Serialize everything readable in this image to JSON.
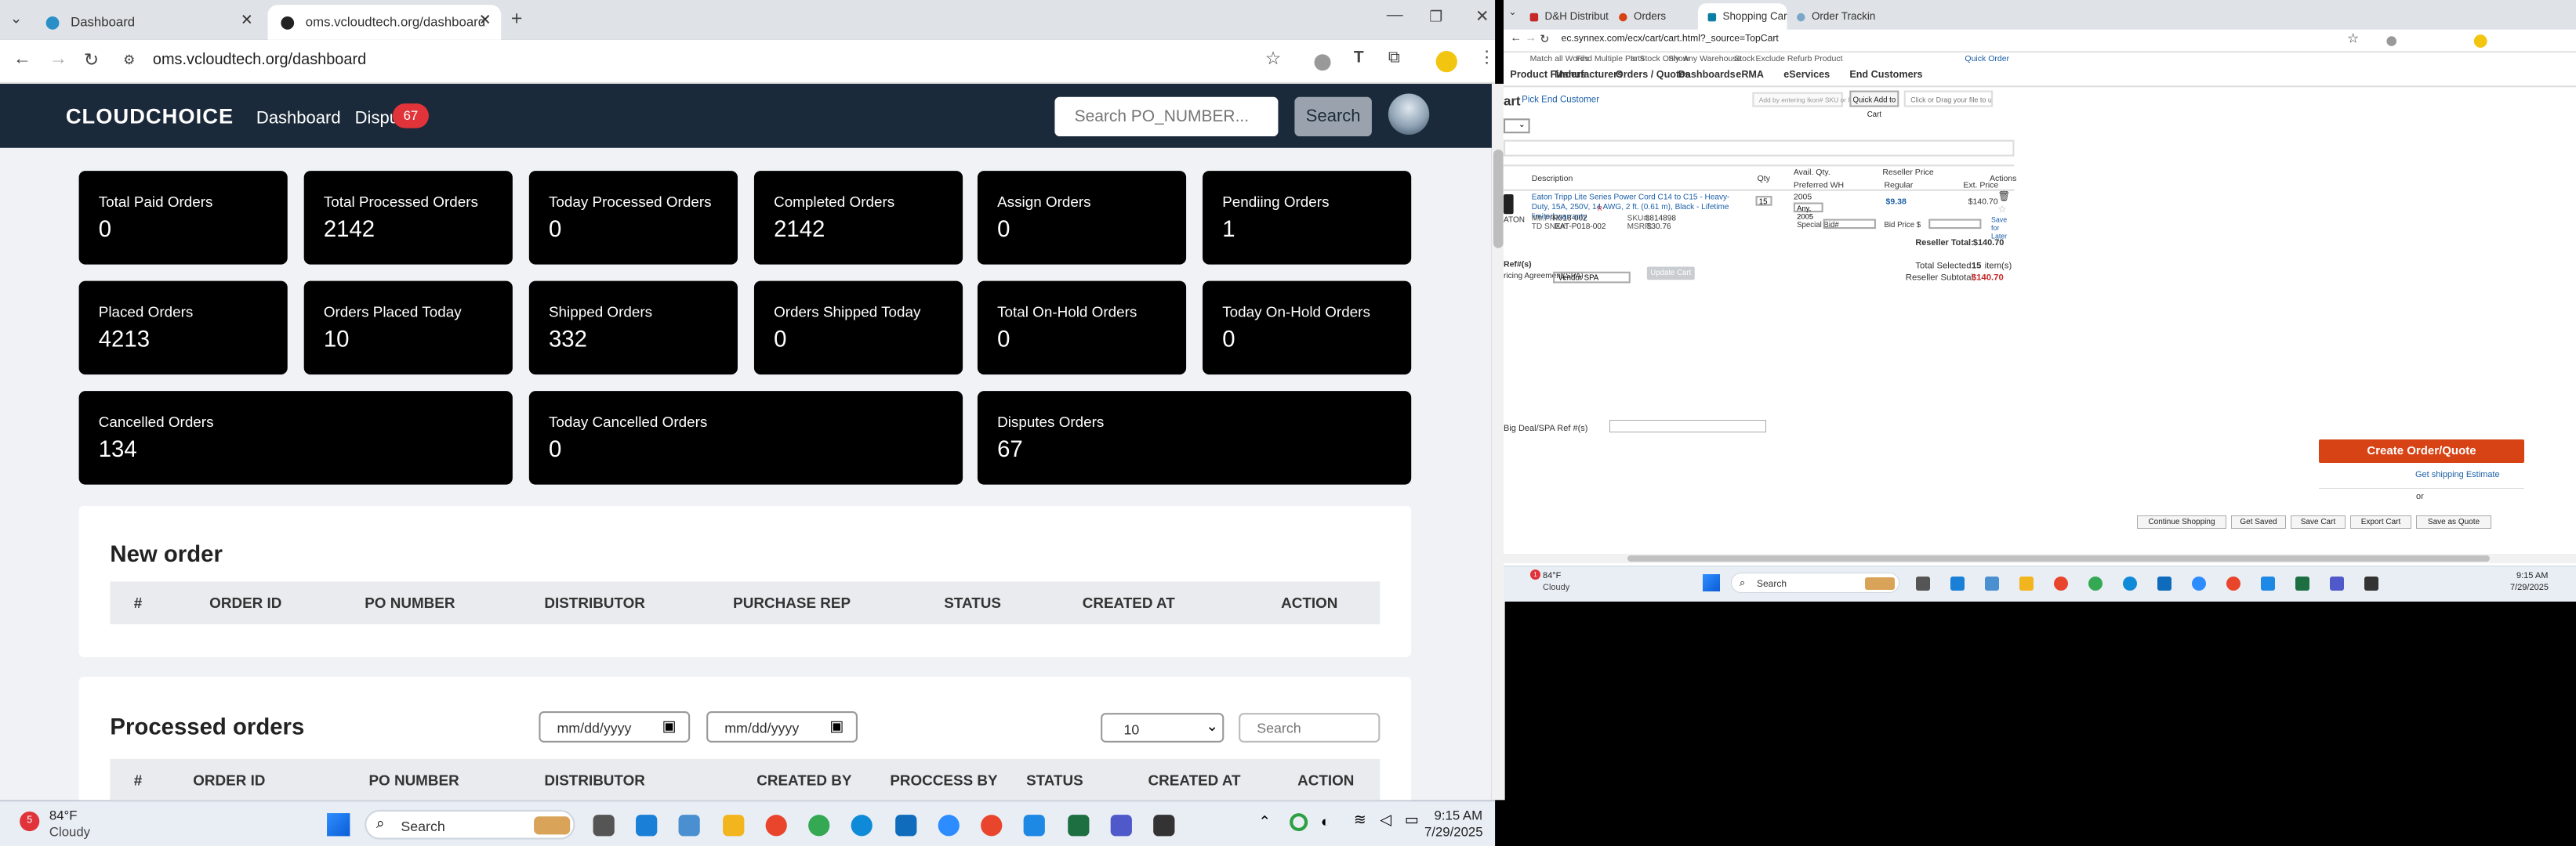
{
  "left_window": {
    "tabs": [
      {
        "title": "Dashboard"
      },
      {
        "title": "oms.vcloudtech.org/dashboard"
      }
    ],
    "new_tab": "+",
    "url": "oms.vcloudtech.org/dashboard",
    "nav": {
      "logo": "CLOUDCHOICE",
      "links": [
        "Dashboard",
        "Dispu"
      ],
      "disputes_badge": "67",
      "search_placeholder": "Search PO_NUMBER...",
      "search_button": "Search"
    },
    "stats": [
      {
        "label": "Total Paid Orders",
        "value": "0"
      },
      {
        "label": "Total Processed Orders",
        "value": "2142"
      },
      {
        "label": "Today Processed Orders",
        "value": "0"
      },
      {
        "label": "Completed Orders",
        "value": "2142"
      },
      {
        "label": "Assign Orders",
        "value": "0"
      },
      {
        "label": "Pendiing Orders",
        "value": "1"
      },
      {
        "label": "Placed Orders",
        "value": "4213"
      },
      {
        "label": "Orders Placed Today",
        "value": "10"
      },
      {
        "label": "Shipped Orders",
        "value": "332"
      },
      {
        "label": "Orders Shipped Today",
        "value": "0"
      },
      {
        "label": "Total On-Hold Orders",
        "value": "0"
      },
      {
        "label": "Today On-Hold Orders",
        "value": "0"
      },
      {
        "label": "Cancelled Orders",
        "value": "134"
      },
      {
        "label": "Today Cancelled Orders",
        "value": "0"
      },
      {
        "label": "Disputes Orders",
        "value": "67"
      }
    ],
    "new_order": {
      "title": "New order",
      "columns": [
        "#",
        "ORDER ID",
        "PO NUMBER",
        "DISTRIBUTOR",
        "PURCHASE REP",
        "STATUS",
        "CREATED AT",
        "ACTION"
      ]
    },
    "processed_orders": {
      "title": "Processed orders",
      "date_from_placeholder": "mm/dd/yyyy",
      "date_to_placeholder": "mm/dd/yyyy",
      "page_size": "10",
      "search_placeholder": "Search",
      "columns": [
        "#",
        "ORDER ID",
        "PO NUMBER",
        "DISTRIBUTOR",
        "CREATED BY",
        "PROCCESS BY",
        "STATUS",
        "CREATED AT",
        "ACTION"
      ]
    },
    "taskbar": {
      "weather_temp": "84°F",
      "weather_desc": "Cloudy",
      "weather_badge": "5",
      "search": "Search",
      "time": "9:15 AM",
      "date": "7/29/2025"
    }
  },
  "right_window": {
    "tabs": [
      {
        "title": "D&H Distributing"
      },
      {
        "title": "Orders"
      },
      {
        "title": "Shopping Cart- ECExpress - TD"
      },
      {
        "title": "Order Tracking"
      }
    ],
    "url": "ec.synnex.com/ecx/cart/cart.html?_source=TopCart",
    "filters": [
      "Match all Words",
      "Find Multiple Parts",
      "In Stock Only",
      "Show",
      "Any Warehouse",
      "Stock",
      "Exclude Refurb Product",
      "Quick Order"
    ],
    "menu": [
      "Product Finders",
      "Manufacturers",
      "Orders / Quotes",
      "Dashboards",
      "eRMA",
      "eServices",
      "End Customers"
    ],
    "cart_title": "art",
    "pick_end_customer": "Pick End Customer",
    "add_placeholder": "Add by entering Ikon# SKU or Part Number",
    "quick_add": "Quick Add to Cart",
    "upload_text": "Click or Drag your file to upload (.csv)",
    "headers": {
      "description": "Description",
      "qty": "Qty",
      "avail": "Avail. Qty.",
      "preferred": "Preferred WH",
      "reseller_price": "Reseller Price",
      "regular": "Regular",
      "ext_price": "Ext. Price",
      "actions": "Actions"
    },
    "item": {
      "description": "Eaton Tripp Lite Series Power Cord C14 to C15 - Heavy-Duty, 15A, 250V, 14 AWG, 2 ft. (0.61 m), Black - Lifetime limited warranty",
      "desc_badge": "R",
      "qty": "15",
      "avail": "2005",
      "warehouse": "Any, 2005",
      "regular": "$9.38",
      "ext": "$140.70",
      "vendor": "ATON",
      "mfr_pn_label": "Mfr.P/N:",
      "mfr_pn": "P018-002",
      "td_snx_label": "TD SNX#:",
      "td_snx": "EAT-P018-002",
      "sku_label": "SKU#:",
      "sku": "3814898",
      "msrp_label": "MSRP:",
      "msrp": "$30.76",
      "special_bid": "Special Bid#",
      "bid_price": "Bid Price $",
      "save_later": "Save for Later"
    },
    "reseller_total_label": "Reseller Total:",
    "reseller_total": "$140.70",
    "ref": {
      "title": "Ref#(s)",
      "agreement_label": "ricing Agreement(SPA)",
      "agreement_value": "Vendor SPA",
      "big_deal_label": "Big Deal/SPA Ref #(s)"
    },
    "update_cart": "Update Cart",
    "total_selected_label": "Total Selected:",
    "total_selected_value": "15",
    "total_selected_unit": "item(s)",
    "reseller_subtotal_label": "Reseller Subtotal:",
    "reseller_subtotal": "$140.70",
    "create_order": "Create Order/Quote",
    "shipping_estimate": "Get shipping Estimate",
    "or": "or",
    "bottom_buttons": [
      "Continue Shopping",
      "Get Saved",
      "Save Cart",
      "Export Cart",
      "Save as Quote"
    ],
    "taskbar": {
      "weather_temp": "84°F",
      "weather_desc": "Cloudy",
      "weather_badge": "1",
      "search": "Search",
      "time": "9:15 AM",
      "date": "7/29/2025"
    }
  },
  "colors": {
    "nav_bg": "#1b2a3a",
    "card_bg": "#000000",
    "badge": "#e0343a",
    "create_btn": "#d84315",
    "subtotal_red": "#c62828",
    "link_blue": "#1b5fa8"
  },
  "icons": [
    "chrome-icon",
    "close-icon",
    "back-icon",
    "forward-icon",
    "reload-icon",
    "star-icon",
    "extensions-icon",
    "menu-icon",
    "windows-start-icon",
    "search-icon",
    "calendar-icon",
    "trash-icon",
    "chevron-down-icon"
  ]
}
